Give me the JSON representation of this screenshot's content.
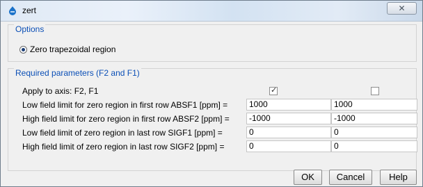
{
  "window": {
    "title": "zert",
    "close_glyph": "✕"
  },
  "options": {
    "group_title": "Options",
    "radio_label": "Zero trapezoidal region",
    "radio_selected": true
  },
  "required": {
    "group_title": "Required parameters (F2 and F1)",
    "apply_label": "Apply to axis: F2, F1",
    "apply_f2_checked": true,
    "apply_f1_checked": false,
    "rows": [
      {
        "label": "Low field limit for zero region in first row ABSF1 [ppm] =",
        "f2": "1000",
        "f1": "1000"
      },
      {
        "label": "High field limit for zero region in first row ABSF2 [ppm] =",
        "f2": "-1000",
        "f1": "-1000"
      },
      {
        "label": "Low field limit of zero region in last row SIGF1 [ppm] =",
        "f2": "0",
        "f1": "0"
      },
      {
        "label": "High field limit of zero region in last row SIGF2 [ppm] =",
        "f2": "0",
        "f1": "0"
      }
    ]
  },
  "buttons": {
    "ok": "OK",
    "cancel": "Cancel",
    "help": "Help"
  },
  "colors": {
    "group_title": "#0b4fb6",
    "window_bg": "#f0f0f0",
    "title_bar": "#dfe9f5"
  },
  "icons": {
    "app": "topspin-app-icon",
    "close": "close-icon"
  }
}
